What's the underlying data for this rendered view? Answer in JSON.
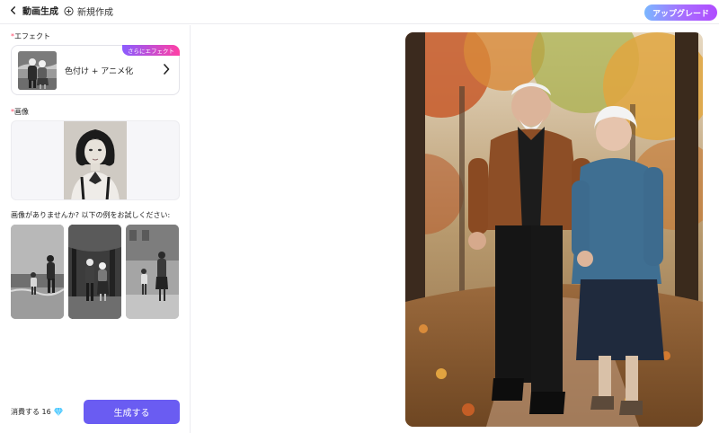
{
  "topbar": {
    "back_label": "動画生成",
    "new_task_label": "新規作成",
    "upgrade_label": "アップグレード"
  },
  "sidebar": {
    "effect_label": "エフェクト",
    "effect": {
      "title": "色付け + アニメ化",
      "badge": "さらにエフェクト"
    },
    "image_label": "画像",
    "examples_label": "画像がありませんか? 以下の例をお試しください:",
    "examples": [
      {
        "name": "beach-walk-example"
      },
      {
        "name": "park-couple-example"
      },
      {
        "name": "street-family-example"
      }
    ]
  },
  "footer": {
    "cost_label": "消費する 16",
    "generate_label": "生成する"
  },
  "colors": {
    "accent": "#6a5cf2",
    "required_mark": "#ff4d6d",
    "badge_gradient": [
      "#8b5cff",
      "#ff3fa4"
    ],
    "upgrade_gradient": [
      "#7ab7ff",
      "#b04cff"
    ]
  }
}
